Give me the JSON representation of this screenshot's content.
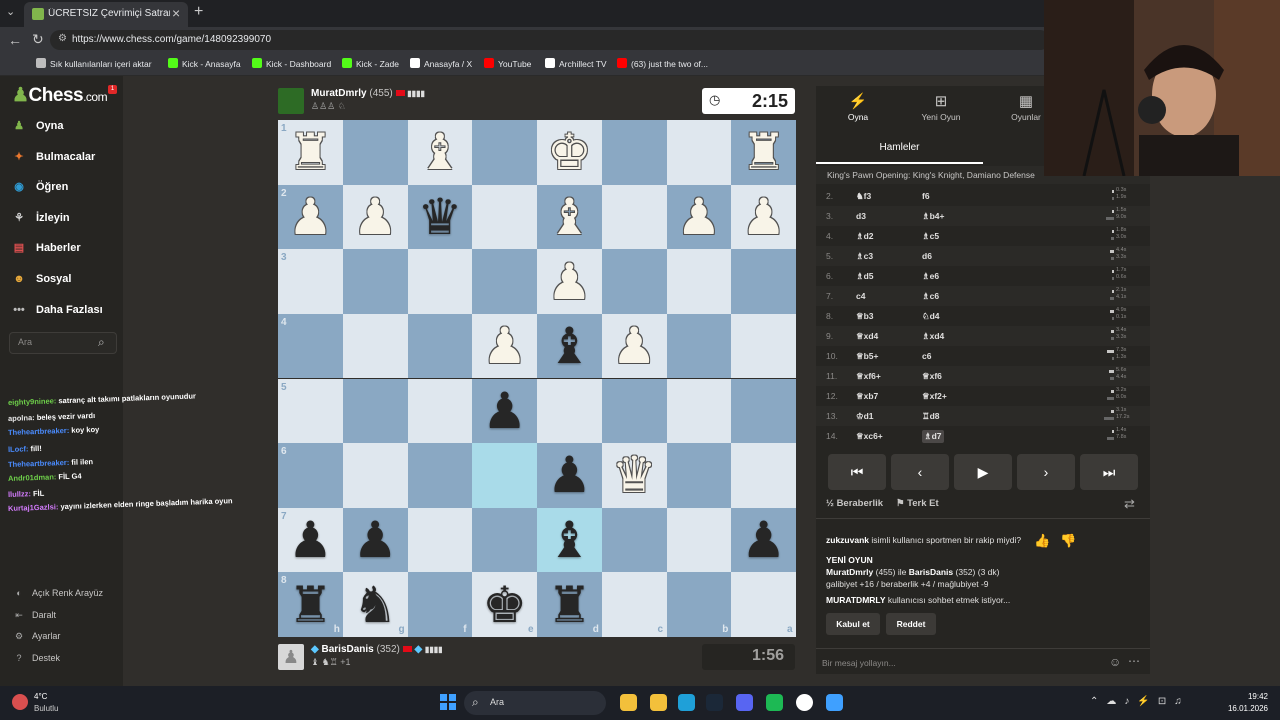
{
  "browser": {
    "tab_title": "ÜCRETSİZ Çevrimiçi Satranç Oyna",
    "url": "https://www.chess.com/game/148092399070",
    "bookmarks": [
      {
        "label": "Sık kullanılanları içeri aktar",
        "icon": "folder-icon",
        "color": "#bdbdbd"
      },
      {
        "label": "Kick - Anasayfa",
        "icon": "kick-icon",
        "color": "#53fc18"
      },
      {
        "label": "Kick - Dashboard",
        "icon": "kick-icon",
        "color": "#53fc18"
      },
      {
        "label": "Kick - Zade",
        "icon": "kick-icon",
        "color": "#53fc18"
      },
      {
        "label": "Anasayfa / X",
        "icon": "x-icon",
        "color": "#ffffff"
      },
      {
        "label": "YouTube",
        "icon": "youtube-icon",
        "color": "#ff0000"
      },
      {
        "label": "Archillect TV",
        "icon": "archillect-icon",
        "color": "#ffffff"
      },
      {
        "label": "(63) just the two of...",
        "icon": "youtube-icon",
        "color": "#ff0000"
      }
    ]
  },
  "sidebar": {
    "logo_left": "Chess",
    "logo_right": ".com",
    "badge": "1",
    "items": [
      {
        "label": "Oyna",
        "icon": "pawn-icon",
        "color": "#81b64c"
      },
      {
        "label": "Bulmacalar",
        "icon": "puzzle-icon",
        "color": "#e8772e"
      },
      {
        "label": "Öğren",
        "icon": "learn-icon",
        "color": "#2f9bd3"
      },
      {
        "label": "İzleyin",
        "icon": "binoculars-icon",
        "color": "#cfcfcf"
      },
      {
        "label": "Haberler",
        "icon": "news-icon",
        "color": "#d94f4f"
      },
      {
        "label": "Sosyal",
        "icon": "social-icon",
        "color": "#e8a93b"
      },
      {
        "label": "Daha Fazlası",
        "icon": "more-icon",
        "color": "#bdbdbd"
      }
    ],
    "search_placeholder": "Ara",
    "footer": [
      {
        "label": "Açık Renk Arayüz",
        "icon": "theme-icon"
      },
      {
        "label": "Daralt",
        "icon": "collapse-icon"
      },
      {
        "label": "Ayarlar",
        "icon": "settings-icon"
      },
      {
        "label": "Destek",
        "icon": "help-icon"
      }
    ]
  },
  "chat_overlay": [
    {
      "user": "eighty9ninee:",
      "text": "satranç alt takımı patlakların oyunudur",
      "color": "#6ecf4a"
    },
    {
      "user": "apolna:",
      "text": "beleş vezir vardı",
      "color": "#e6e6e6"
    },
    {
      "user": "Theheartbreaker:",
      "text": "koy koy",
      "color": "#4a8cff"
    },
    {
      "user": "lLocf:",
      "text": "fill!",
      "color": "#4a8cff"
    },
    {
      "user": "Theheartbreaker:",
      "text": "fil ilen",
      "color": "#4a8cff"
    },
    {
      "user": "Andr01dman:",
      "text": "FİL G4",
      "color": "#6ecf4a"
    },
    {
      "user": "llullzz:",
      "text": "FİL",
      "color": "#d57cff"
    },
    {
      "user": "Kurtaj1Gazlsi:",
      "text": "yayını izlerken elden ringe başladım harika oyun",
      "color": "#d57cff"
    }
  ],
  "top_player": {
    "name": "MuratDmrly",
    "rating": "(455)",
    "flag": "TR",
    "clock": "2:15"
  },
  "bottom_player": {
    "name": "BarisDanis",
    "rating": "(352)",
    "flag": "TR",
    "extra": "+1",
    "clock": "1:56"
  },
  "board": {
    "ranks": [
      "1",
      "2",
      "3",
      "4",
      "5",
      "6",
      "7",
      "8"
    ],
    "files": [
      "h",
      "g",
      "f",
      "e",
      "d",
      "c",
      "b",
      "a"
    ],
    "highlight": [
      "e6",
      "d7"
    ],
    "pieces": [
      {
        "sq": "h1",
        "color": "w",
        "glyph": "♜",
        "name": "white-rook"
      },
      {
        "sq": "f1",
        "color": "w",
        "glyph": "♝",
        "name": "white-bishop"
      },
      {
        "sq": "d1",
        "color": "w",
        "glyph": "♚",
        "name": "white-king"
      },
      {
        "sq": "a1",
        "color": "w",
        "glyph": "♜",
        "name": "white-rook"
      },
      {
        "sq": "h2",
        "color": "w",
        "glyph": "♟",
        "name": "white-pawn"
      },
      {
        "sq": "g2",
        "color": "w",
        "glyph": "♟",
        "name": "white-pawn"
      },
      {
        "sq": "f2",
        "color": "b",
        "glyph": "♛",
        "name": "black-queen"
      },
      {
        "sq": "d2",
        "color": "w",
        "glyph": "♝",
        "name": "white-bishop"
      },
      {
        "sq": "b2",
        "color": "w",
        "glyph": "♟",
        "name": "white-pawn"
      },
      {
        "sq": "a2",
        "color": "w",
        "glyph": "♟",
        "name": "white-pawn"
      },
      {
        "sq": "d3",
        "color": "w",
        "glyph": "♟",
        "name": "white-pawn"
      },
      {
        "sq": "e4",
        "color": "w",
        "glyph": "♟",
        "name": "white-pawn"
      },
      {
        "sq": "d4",
        "color": "b",
        "glyph": "♝",
        "name": "black-bishop"
      },
      {
        "sq": "c4",
        "color": "w",
        "glyph": "♟",
        "name": "white-pawn"
      },
      {
        "sq": "e5",
        "color": "b",
        "glyph": "♟",
        "name": "black-pawn"
      },
      {
        "sq": "d6",
        "color": "b",
        "glyph": "♟",
        "name": "black-pawn"
      },
      {
        "sq": "c6",
        "color": "w",
        "glyph": "♛",
        "name": "white-queen"
      },
      {
        "sq": "h7",
        "color": "b",
        "glyph": "♟",
        "name": "black-pawn"
      },
      {
        "sq": "g7",
        "color": "b",
        "glyph": "♟",
        "name": "black-pawn"
      },
      {
        "sq": "d7",
        "color": "b",
        "glyph": "♝",
        "name": "black-bishop"
      },
      {
        "sq": "a7",
        "color": "b",
        "glyph": "♟",
        "name": "black-pawn"
      },
      {
        "sq": "h8",
        "color": "b",
        "glyph": "♜",
        "name": "black-rook"
      },
      {
        "sq": "g8",
        "color": "b",
        "glyph": "♞",
        "name": "black-knight"
      },
      {
        "sq": "e8",
        "color": "b",
        "glyph": "♚",
        "name": "black-king"
      },
      {
        "sq": "d8",
        "color": "b",
        "glyph": "♜",
        "name": "black-rook"
      }
    ]
  },
  "right_panel": {
    "tabs": [
      {
        "label": "Oyna",
        "icon": "play-icon",
        "glyph": "⚡"
      },
      {
        "label": "Yeni Oyun",
        "icon": "plus-icon",
        "glyph": "⊞"
      },
      {
        "label": "Oyunlar",
        "icon": "games-icon",
        "glyph": "▦"
      }
    ],
    "moves_tab": "Hamleler",
    "opening": "King's Pawn Opening: King's Knight, Damiano Defense",
    "moves": [
      {
        "n": "2.",
        "w": "♞f3",
        "b": "f6",
        "tw": "0.3s",
        "tb": "1.9s",
        "bw": 0.1,
        "bb": 0.2
      },
      {
        "n": "3.",
        "w": "d3",
        "b": "♗b4+",
        "tw": "1.5s",
        "tb": "9.0s",
        "bw": 0.1,
        "bb": 0.8
      },
      {
        "n": "4.",
        "w": "♗d2",
        "b": "♗c5",
        "tw": "1.8s",
        "tb": "3.0s",
        "bw": 0.15,
        "bb": 0.3
      },
      {
        "n": "5.",
        "w": "♗c3",
        "b": "d6",
        "tw": "4.4s",
        "tb": "3.3s",
        "bw": 0.4,
        "bb": 0.3
      },
      {
        "n": "6.",
        "w": "♗d5",
        "b": "♗e6",
        "tw": "1.7s",
        "tb": "0.6s",
        "bw": 0.15,
        "bb": 0.05
      },
      {
        "n": "7.",
        "w": "c4",
        "b": "♗c6",
        "tw": "2.1s",
        "tb": "4.1s",
        "bw": 0.2,
        "bb": 0.4
      },
      {
        "n": "8.",
        "w": "♕b3",
        "b": "♘d4",
        "tw": "4.9s",
        "tb": "0.1s",
        "bw": 0.45,
        "bb": 0.02
      },
      {
        "n": "9.",
        "w": "♕xd4",
        "b": "♗xd4",
        "tw": "3.4s",
        "tb": "3.3s",
        "bw": 0.3,
        "bb": 0.3
      },
      {
        "n": "10.",
        "w": "♕b5+",
        "b": "c6",
        "tw": "7.3s",
        "tb": "1.3s",
        "bw": 0.7,
        "bb": 0.1
      },
      {
        "n": "11.",
        "w": "♕xf6+",
        "b": "♕xf6",
        "tw": "5.6s",
        "tb": "4.4s",
        "bw": 0.5,
        "bb": 0.4
      },
      {
        "n": "12.",
        "w": "♕xb7",
        "b": "♕xf2+",
        "tw": "3.2s",
        "tb": "8.0s",
        "bw": 0.3,
        "bb": 0.75
      },
      {
        "n": "13.",
        "w": "♔d1",
        "b": "♖d8",
        "tw": "3.1s",
        "tb": "17.2s",
        "bw": 0.3,
        "bb": 1.0
      },
      {
        "n": "14.",
        "w": "♕xc6+",
        "b": "♗d7",
        "tw": "1.4s",
        "tb": "7.8s",
        "bw": 0.12,
        "bb": 0.7
      }
    ],
    "draw_label": "Beraberlik",
    "resign_label": "Terk Et",
    "chat": {
      "q_user": "zukzuvank",
      "q_text": "isimli kullanıcı sportmen bir rakip miydi?",
      "new_game_title": "YENİ OYUN",
      "ng_p1": "MuratDmrly",
      "ng_p1_rating": "(455)",
      "ng_with": "ile",
      "ng_p2": "BarisDanis",
      "ng_p2_rating": "(352)",
      "ng_tc": "(3 dk)",
      "ng_stakes": "galibiyet +16 / beraberlik +4 / mağlubiyet -9",
      "req_user": "MURATDMRLY",
      "req_text": "kullanıcısı sohbet etmek istiyor...",
      "accept": "Kabul et",
      "decline": "Reddet"
    },
    "chat_placeholder": "Bir mesaj yollayın..."
  },
  "taskbar": {
    "temp": "4°C",
    "weather": "Bulutlu",
    "search": "Ara",
    "time": "19:42",
    "date": "16.01.2026",
    "apps": [
      {
        "name": "explorer-app-icon",
        "color": "#f3c03b"
      },
      {
        "name": "files-app-icon",
        "color": "#f3c03b"
      },
      {
        "name": "edge-app-icon",
        "color": "#1fa0d8"
      },
      {
        "name": "steam-app-icon",
        "color": "#1b2838"
      },
      {
        "name": "discord-app-icon",
        "color": "#5865f2"
      },
      {
        "name": "spotify-app-icon",
        "color": "#1db954"
      },
      {
        "name": "unreal-app-icon",
        "color": "#ffffff"
      },
      {
        "name": "other-app-icon",
        "color": "#3fa0ff"
      }
    ]
  }
}
